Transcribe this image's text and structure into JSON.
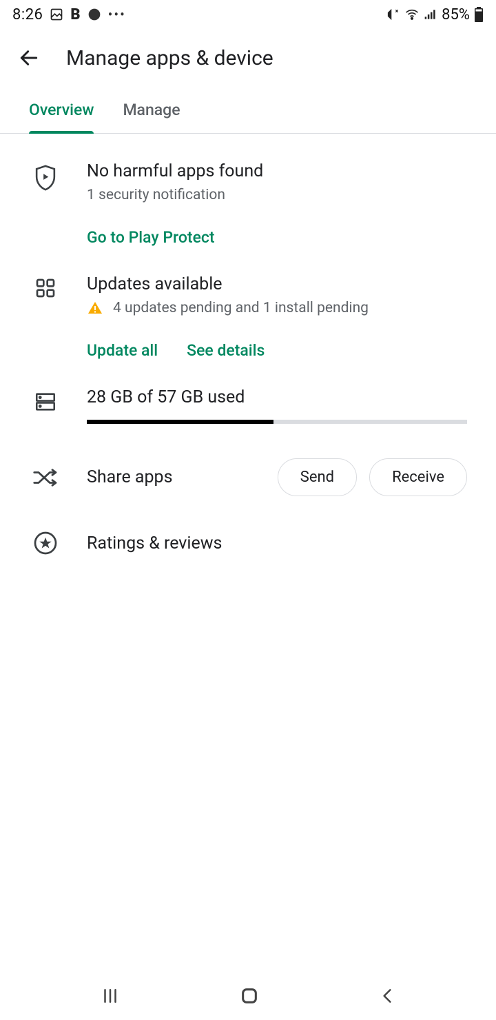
{
  "status": {
    "time": "8:26",
    "battery_text": "85%"
  },
  "header": {
    "title": "Manage apps & device"
  },
  "tabs": {
    "overview": "Overview",
    "manage": "Manage"
  },
  "protect": {
    "title": "No harmful apps found",
    "subtitle": "1 security notification",
    "action": "Go to Play Protect"
  },
  "updates": {
    "title": "Updates available",
    "subtitle": "4 updates pending and 1 install pending",
    "update_all": "Update all",
    "see_details": "See details"
  },
  "storage": {
    "label": "28 GB of 57 GB used",
    "used": 28,
    "total": 57
  },
  "share": {
    "label": "Share apps",
    "send": "Send",
    "receive": "Receive"
  },
  "ratings": {
    "label": "Ratings & reviews"
  }
}
